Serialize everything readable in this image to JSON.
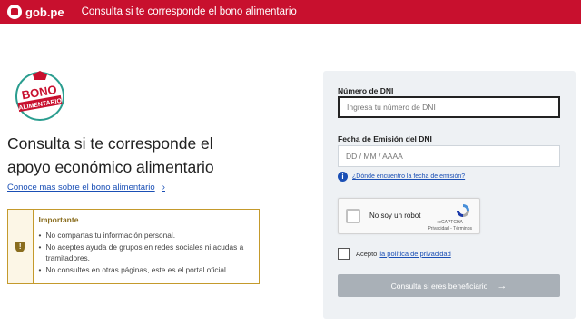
{
  "header": {
    "logo_text": "gob.pe",
    "title": "Consulta si te corresponde el bono alimentario"
  },
  "badge": {
    "line1": "BONO",
    "line2": "ALIMENTARIO"
  },
  "main": {
    "heading_line1": "Consulta si te corresponde el",
    "heading_line2": "apoyo económico alimentario",
    "more_link": "Conoce mas sobre el bono alimentario"
  },
  "notice": {
    "title": "Importante",
    "items": [
      "No compartas tu información personal.",
      "No aceptes ayuda de grupos en redes sociales ni acudas a tramitadores.",
      "No consultes en otras páginas, este es el portal oficial."
    ]
  },
  "form": {
    "dni_label": "Número de DNI",
    "dni_placeholder": "Ingresa tu número de DNI",
    "date_label": "Fecha de Emisión del DNI",
    "date_placeholder": "DD / MM / AAAA",
    "help_link": "¿Dónde encuentro la fecha de emisión?",
    "captcha_text": "No soy un robot",
    "captcha_brand": "reCAPTCHA",
    "captcha_terms": "Privacidad - Términos",
    "consent_text": "Acepto",
    "consent_link": "la política de privacidad",
    "submit_label": "Consulta si eres beneficiario"
  },
  "colors": {
    "brand": "#c8102e",
    "link": "#1a4fb5",
    "notice_border": "#c49a2c",
    "button_disabled": "#a9b0b7"
  },
  "icons": {
    "logo": "gob-pe-logo-icon",
    "chevron": "chevron-right-icon",
    "shield": "shield-icon",
    "info": "info-icon",
    "arrow": "arrow-right-icon"
  }
}
